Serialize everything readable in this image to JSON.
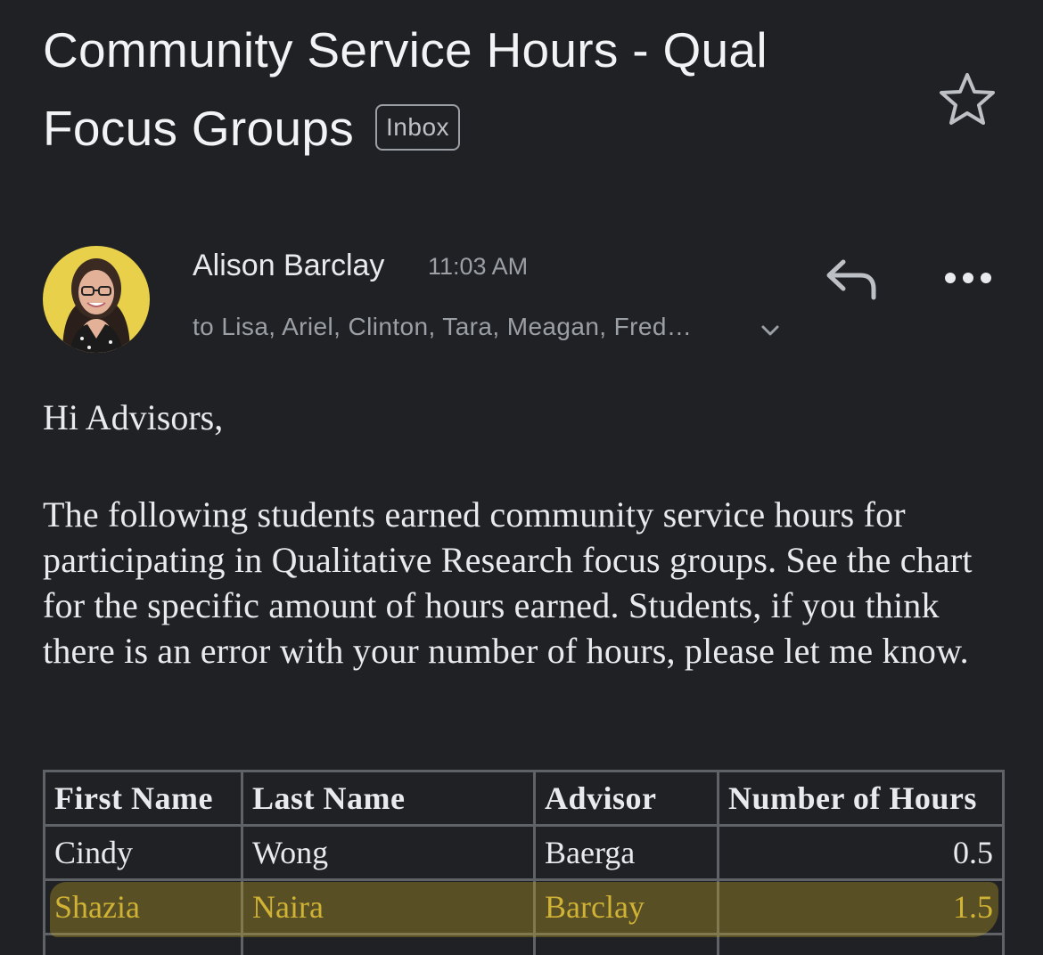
{
  "email": {
    "subject": "Community Service Hours - Qual Focus Groups",
    "label": "Inbox",
    "icons": {
      "star": "star-outline-icon",
      "reply": "reply-icon",
      "more": "more-horizontal-icon",
      "expand": "chevron-down-icon"
    },
    "sender": {
      "name": "Alison Barclay",
      "time": "11:03 AM",
      "recipients": "to Lisa, Ariel, Clinton, Tara, Meagan, Fred…"
    },
    "body": {
      "greeting": "Hi Advisors,",
      "paragraph": "The following students earned community service hours for participating in Qualitative Research focus groups. See the chart for the specific amount of hours earned. Students, if you think there is an error with your number of hours, please let me know."
    },
    "table": {
      "headers": [
        "First Name",
        "Last Name",
        "Advisor",
        "Number of Hours"
      ],
      "rows": [
        [
          "Cindy",
          "Wong",
          "Baerga",
          "0.5"
        ],
        [
          "Shazia",
          "Naira",
          "Barclay",
          "1.5"
        ],
        [
          "",
          "",
          "",
          ""
        ]
      ],
      "highlighted_row": 1,
      "highlight_color": "#c4a624"
    }
  }
}
